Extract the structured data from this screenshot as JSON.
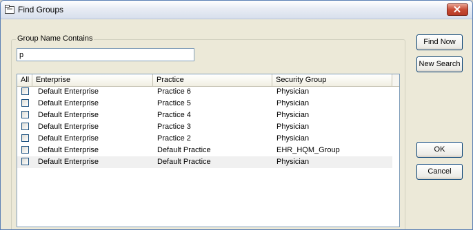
{
  "window": {
    "title": "Find Groups",
    "icon": "folder-icon"
  },
  "search": {
    "group_label": "Group Name Contains",
    "value": "p"
  },
  "table": {
    "columns": [
      "All",
      "Enterprise",
      "Practice",
      "Security Group"
    ],
    "rows": [
      {
        "checked": false,
        "enterprise": "Default Enterprise",
        "practice": "Practice 6",
        "security_group": "Physician"
      },
      {
        "checked": false,
        "enterprise": "Default Enterprise",
        "practice": "Practice 5",
        "security_group": "Physician"
      },
      {
        "checked": false,
        "enterprise": "Default Enterprise",
        "practice": "Practice 4",
        "security_group": "Physician"
      },
      {
        "checked": false,
        "enterprise": "Default Enterprise",
        "practice": "Practice 3",
        "security_group": "Physician"
      },
      {
        "checked": false,
        "enterprise": "Default Enterprise",
        "practice": "Practice 2",
        "security_group": "Physician"
      },
      {
        "checked": false,
        "enterprise": "Default Enterprise",
        "practice": "Default Practice",
        "security_group": "EHR_HQM_Group"
      },
      {
        "checked": false,
        "enterprise": "Default Enterprise",
        "practice": "Default Practice",
        "security_group": "Physician"
      }
    ]
  },
  "buttons": {
    "find_now": "Find Now",
    "new_search": "New Search",
    "ok": "OK",
    "cancel": "Cancel"
  }
}
